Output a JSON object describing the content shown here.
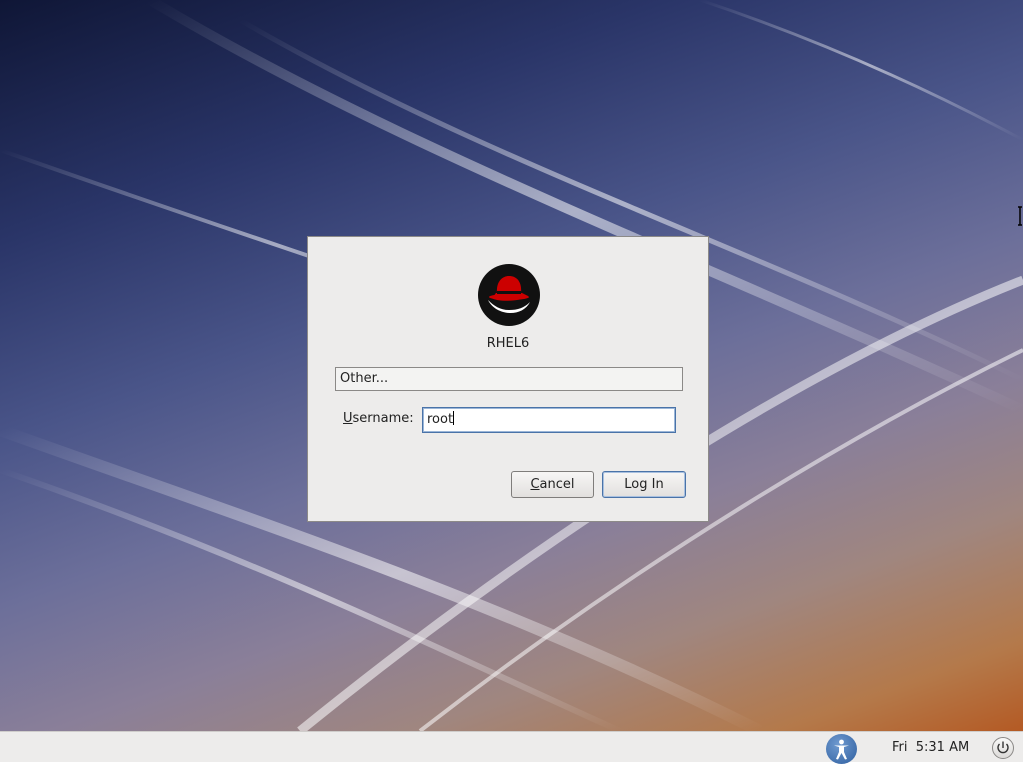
{
  "login_dialog": {
    "hostname": "RHEL6",
    "user_list_selected": "Other...",
    "username_label_underline": "U",
    "username_label_rest": "sername:",
    "username_value": "root",
    "cancel_mnemonic": "C",
    "cancel_rest": "ancel",
    "login_label": "Log In",
    "logo_icon": "redhat-shadowman-icon"
  },
  "panel": {
    "accessibility_icon": "accessibility-icon",
    "clock": "Fri  5:31 AM",
    "power_icon": "power-icon"
  },
  "colors": {
    "dialog_bg": "#edeceb",
    "focus_border": "#4a73a8",
    "redhat_red": "#cc0000"
  }
}
